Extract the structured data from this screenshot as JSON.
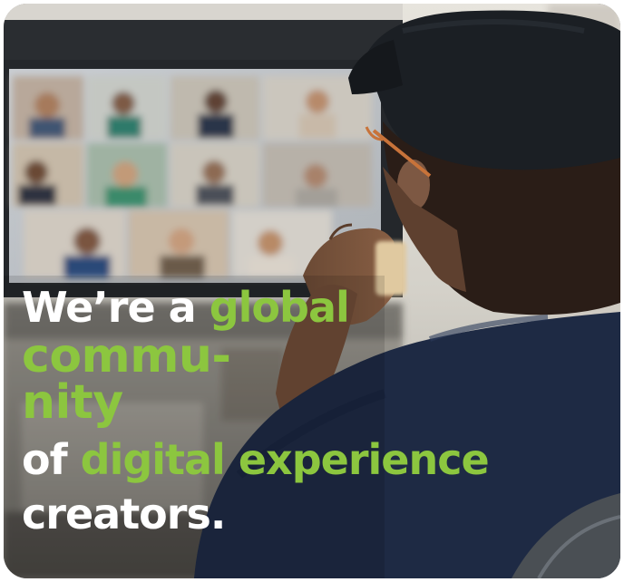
{
  "headline": {
    "line1_white": "We’re a",
    "line1_green": "global",
    "line2_green": "commu-",
    "line3_green": "nity",
    "line4_white": "of",
    "line4_green": "digital experience",
    "line5_white": "creators."
  },
  "colors": {
    "accent_green": "#8cc63f",
    "text_white": "#ffffff",
    "shirt_navy": "#1e2a44"
  }
}
